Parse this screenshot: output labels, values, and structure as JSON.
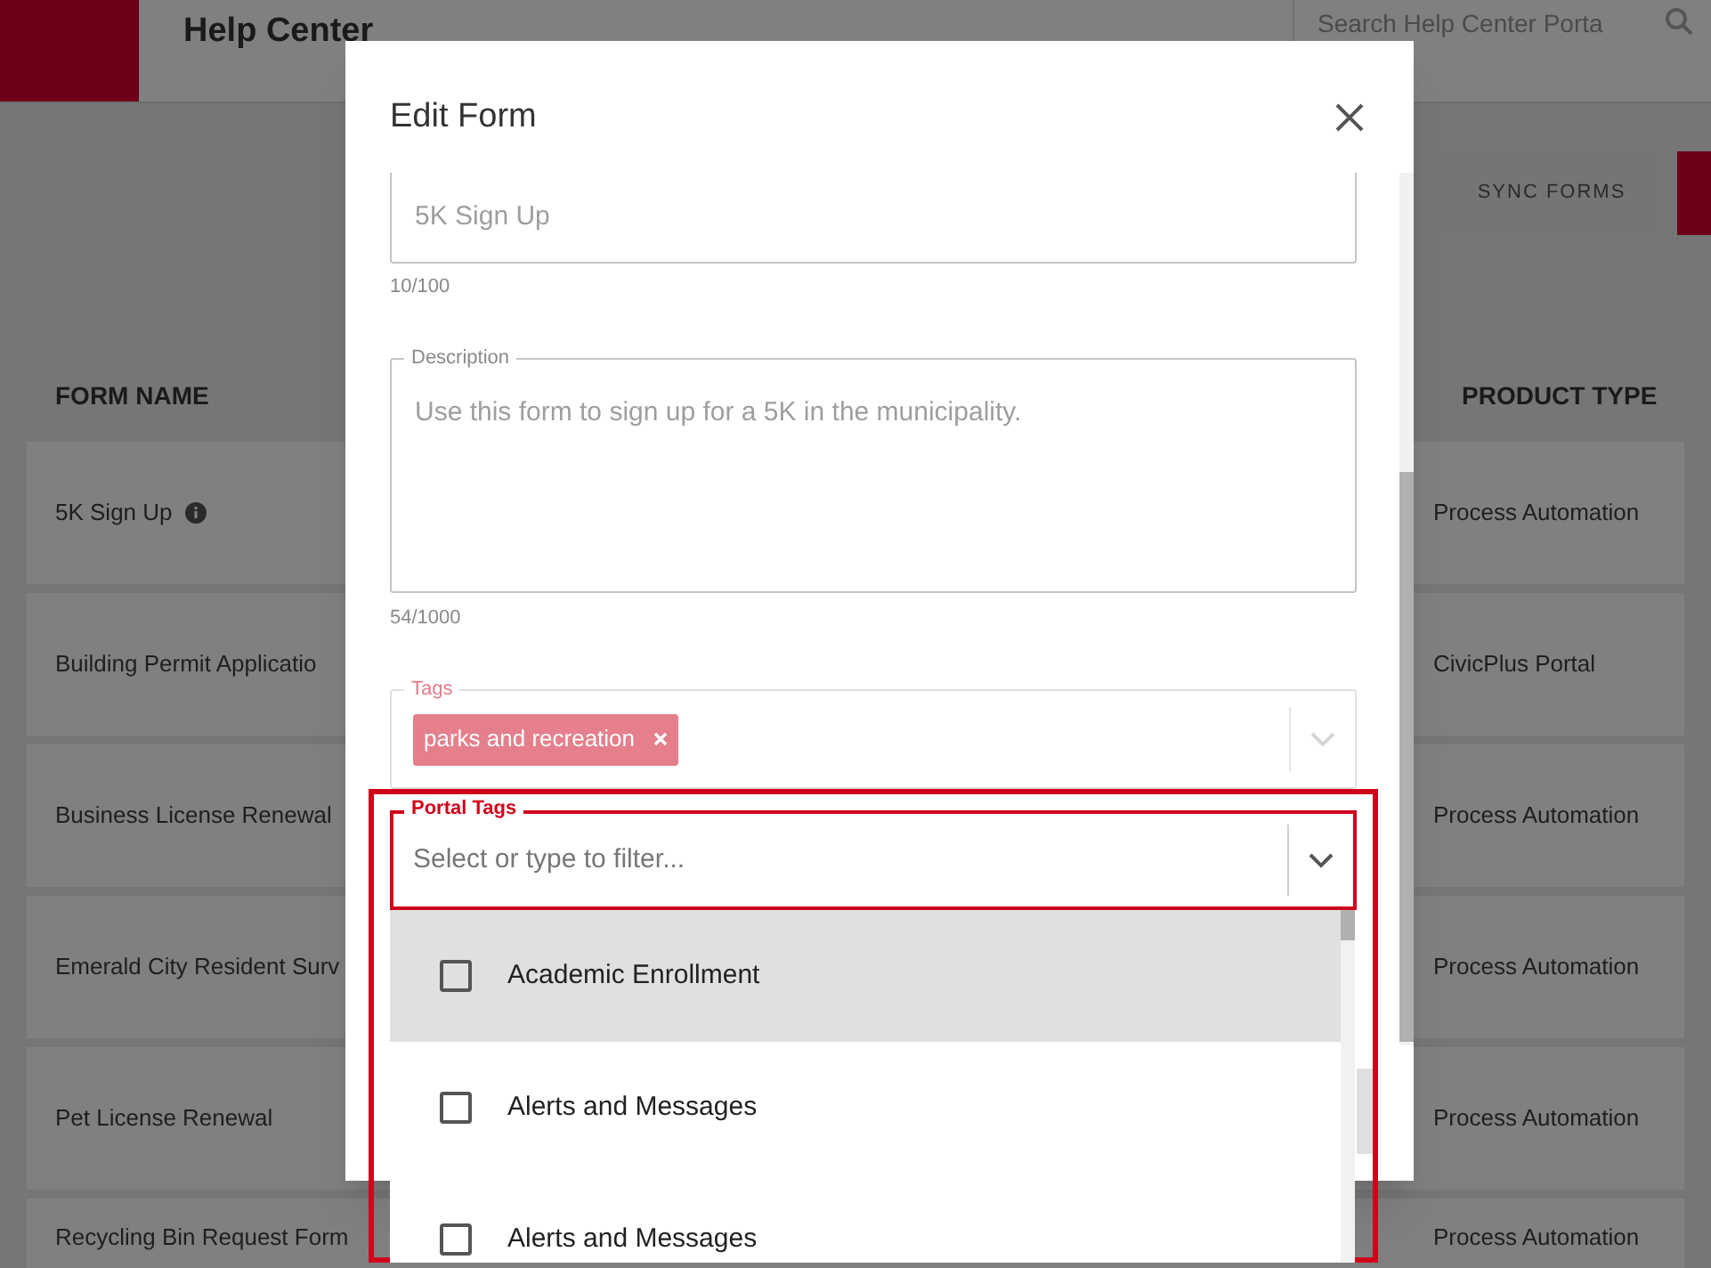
{
  "header": {
    "title": "Help Center",
    "search": {
      "placeholder": "Search Help Center Porta"
    }
  },
  "toolbar": {
    "buttons": [
      "SYNC FORMS"
    ]
  },
  "table": {
    "columns": [
      "FORM NAME",
      "PRODUCT TYPE"
    ],
    "rows": [
      {
        "form_name": "5K Sign Up",
        "info": true,
        "product_type": "Process Automation"
      },
      {
        "form_name": "Building Permit Applicatio",
        "info": false,
        "product_type": "CivicPlus Portal"
      },
      {
        "form_name": "Business License Renewal",
        "info": false,
        "product_type": "Process Automation"
      },
      {
        "form_name": "Emerald City Resident Surv",
        "info": false,
        "product_type": "Process Automation"
      },
      {
        "form_name": "Pet License Renewal",
        "info": false,
        "product_type": "Process Automation"
      },
      {
        "form_name": "Recycling Bin Request Form",
        "info": false,
        "product_type": "Process Automation"
      }
    ]
  },
  "modal": {
    "title": "Edit Form",
    "title_field": {
      "value": "5K Sign Up",
      "counter": "10/100"
    },
    "description_field": {
      "label": "Description",
      "value": "Use this form to sign up for a 5K in the municipality.",
      "counter": "54/1000"
    },
    "tags_field": {
      "label": "Tags",
      "chips": [
        "parks and recreation"
      ]
    },
    "portal_tags_field": {
      "label": "Portal Tags",
      "placeholder": "Select or type to filter...",
      "options": [
        {
          "label": "Academic Enrollment",
          "checked": false,
          "highlighted": true
        },
        {
          "label": "Alerts and Messages",
          "checked": false,
          "highlighted": false
        },
        {
          "label": "Alerts and Messages",
          "checked": false,
          "highlighted": false
        }
      ]
    }
  }
}
